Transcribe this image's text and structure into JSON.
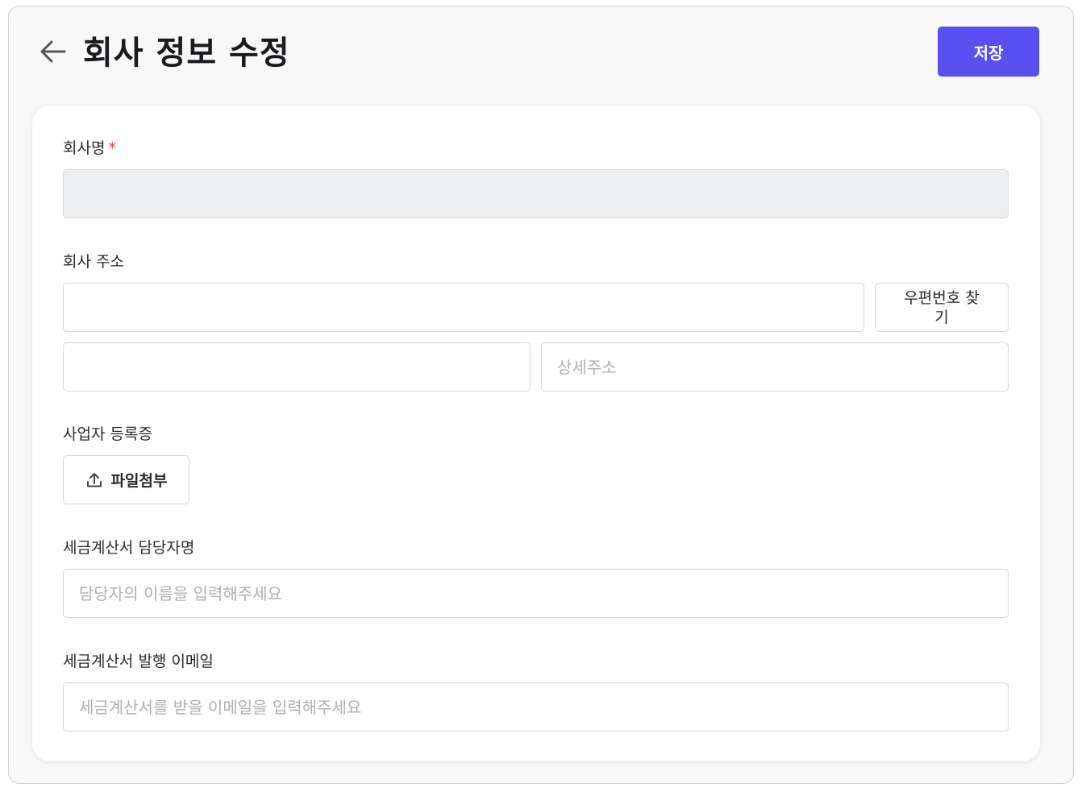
{
  "header": {
    "title": "회사 정보 수정",
    "back_icon": "arrow-left-icon",
    "save_label": "저장"
  },
  "form": {
    "company_name": {
      "label": "회사명",
      "required_mark": "*",
      "value": "",
      "disabled": true
    },
    "company_address": {
      "label": "회사 주소",
      "address_value": "",
      "postcode_button_label": "우편번호 찾기",
      "postcode_value": "",
      "detail_placeholder": "상세주소"
    },
    "business_registration": {
      "label": "사업자 등록증",
      "attach_button_label": "파일첨부",
      "attach_icon": "upload-icon"
    },
    "tax_invoice_manager": {
      "label": "세금계산서 담당자명",
      "placeholder": "담당자의 이름을 입력해주세요"
    },
    "tax_invoice_email": {
      "label": "세금계산서 발행 이메일",
      "placeholder": "세금계산서를 받을 이메일을 입력해주세요"
    }
  },
  "colors": {
    "primary": "#5a50f2",
    "required": "#e03b3b",
    "disabled_bg": "#edeef0",
    "border": "#d6d6db",
    "placeholder": "#b0b0b6",
    "text": "#2b2b2f",
    "page_bg": "#f8f8f9"
  }
}
